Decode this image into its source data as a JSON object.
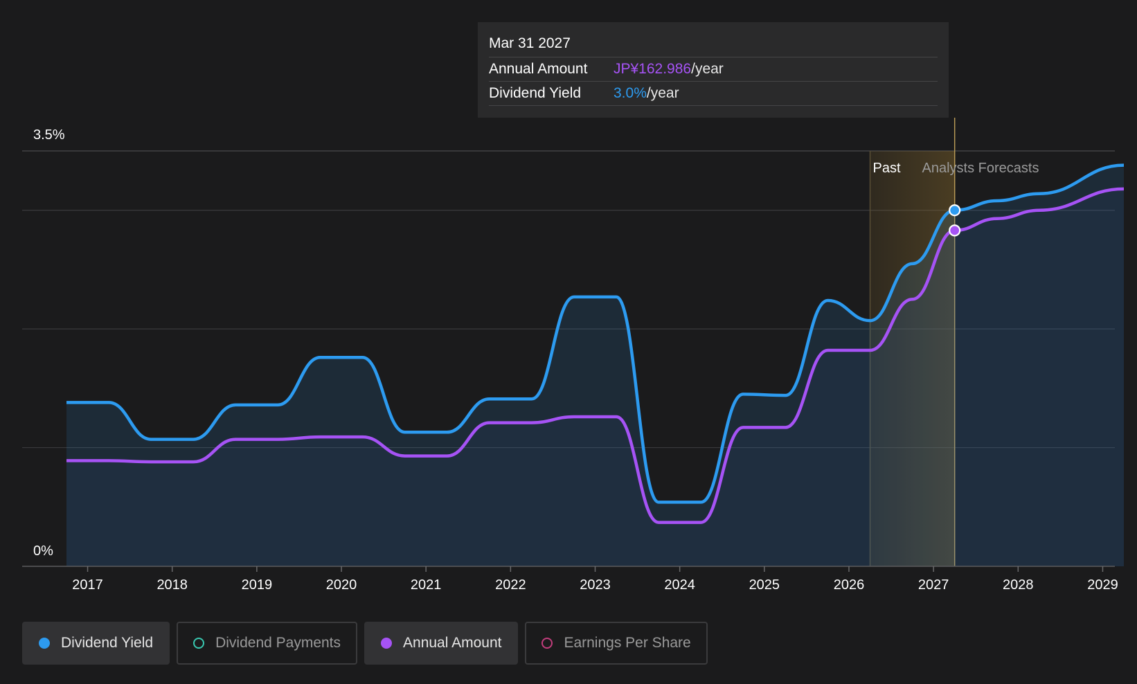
{
  "colors": {
    "background": "#1b1b1c",
    "yield": "#2d9bf0",
    "annual": "#a653f5",
    "payments": "#39c9b1",
    "eps": "#c23d7c",
    "grid": "#3a3a3c",
    "forecast_band": "#8a6b2c"
  },
  "tooltip": {
    "date": "Mar 31 2027",
    "rows": [
      {
        "label": "Annual Amount",
        "value": "JP¥162.986",
        "unit": "/year"
      },
      {
        "label": "Dividend Yield",
        "value": "3.0%",
        "unit": "/year"
      }
    ]
  },
  "legend": [
    {
      "label": "Dividend Yield",
      "active": true,
      "icon": "filled-dot-icon"
    },
    {
      "label": "Dividend Payments",
      "active": false,
      "icon": "hollow-dot-icon"
    },
    {
      "label": "Annual Amount",
      "active": true,
      "icon": "filled-dot-icon"
    },
    {
      "label": "Earnings Per Share",
      "active": false,
      "icon": "hollow-dot-icon"
    }
  ],
  "chart_data": {
    "type": "area",
    "y_tick_labels": {
      "top": "3.5%",
      "bottom": "0%"
    },
    "ylim": [
      0,
      3.5
    ],
    "xlim": [
      2016.68,
      2029.25
    ],
    "x_ticks": [
      2017,
      2018,
      2019,
      2020,
      2021,
      2022,
      2023,
      2024,
      2025,
      2026,
      2027,
      2028,
      2029
    ],
    "grid": true,
    "region_labels": {
      "past": "Past",
      "forecast": "Analysts Forecasts"
    },
    "past_boundary": 2026.25,
    "cursor_x": 2027.25,
    "series": [
      {
        "name": "Dividend Yield",
        "unit": "%",
        "points": [
          [
            2016.75,
            1.38
          ],
          [
            2017.25,
            1.38
          ],
          [
            2017.75,
            1.07
          ],
          [
            2018.25,
            1.07
          ],
          [
            2018.75,
            1.36
          ],
          [
            2019.25,
            1.36
          ],
          [
            2019.75,
            1.76
          ],
          [
            2020.25,
            1.76
          ],
          [
            2020.75,
            1.13
          ],
          [
            2021.25,
            1.13
          ],
          [
            2021.75,
            1.41
          ],
          [
            2022.25,
            1.41
          ],
          [
            2022.75,
            2.27
          ],
          [
            2023.25,
            2.27
          ],
          [
            2023.75,
            0.54
          ],
          [
            2024.25,
            0.54
          ],
          [
            2024.75,
            1.45
          ],
          [
            2025.25,
            1.44
          ],
          [
            2025.75,
            2.24
          ],
          [
            2026.25,
            2.07
          ],
          [
            2026.75,
            2.55
          ],
          [
            2027.25,
            3.0
          ],
          [
            2027.75,
            3.08
          ],
          [
            2028.25,
            3.14
          ],
          [
            2029.25,
            3.38
          ]
        ]
      },
      {
        "name": "Annual Amount",
        "unit": "%",
        "points": [
          [
            2016.75,
            0.89
          ],
          [
            2017.25,
            0.89
          ],
          [
            2017.75,
            0.88
          ],
          [
            2018.25,
            0.88
          ],
          [
            2018.75,
            1.07
          ],
          [
            2019.25,
            1.07
          ],
          [
            2019.75,
            1.09
          ],
          [
            2020.25,
            1.09
          ],
          [
            2020.75,
            0.93
          ],
          [
            2021.25,
            0.93
          ],
          [
            2021.75,
            1.21
          ],
          [
            2022.25,
            1.21
          ],
          [
            2022.75,
            1.26
          ],
          [
            2023.25,
            1.26
          ],
          [
            2023.75,
            0.37
          ],
          [
            2024.25,
            0.37
          ],
          [
            2024.75,
            1.17
          ],
          [
            2025.25,
            1.17
          ],
          [
            2025.75,
            1.82
          ],
          [
            2026.25,
            1.82
          ],
          [
            2026.75,
            2.25
          ],
          [
            2027.25,
            2.83
          ],
          [
            2027.75,
            2.93
          ],
          [
            2028.25,
            3.0
          ],
          [
            2029.25,
            3.18
          ]
        ]
      }
    ]
  }
}
